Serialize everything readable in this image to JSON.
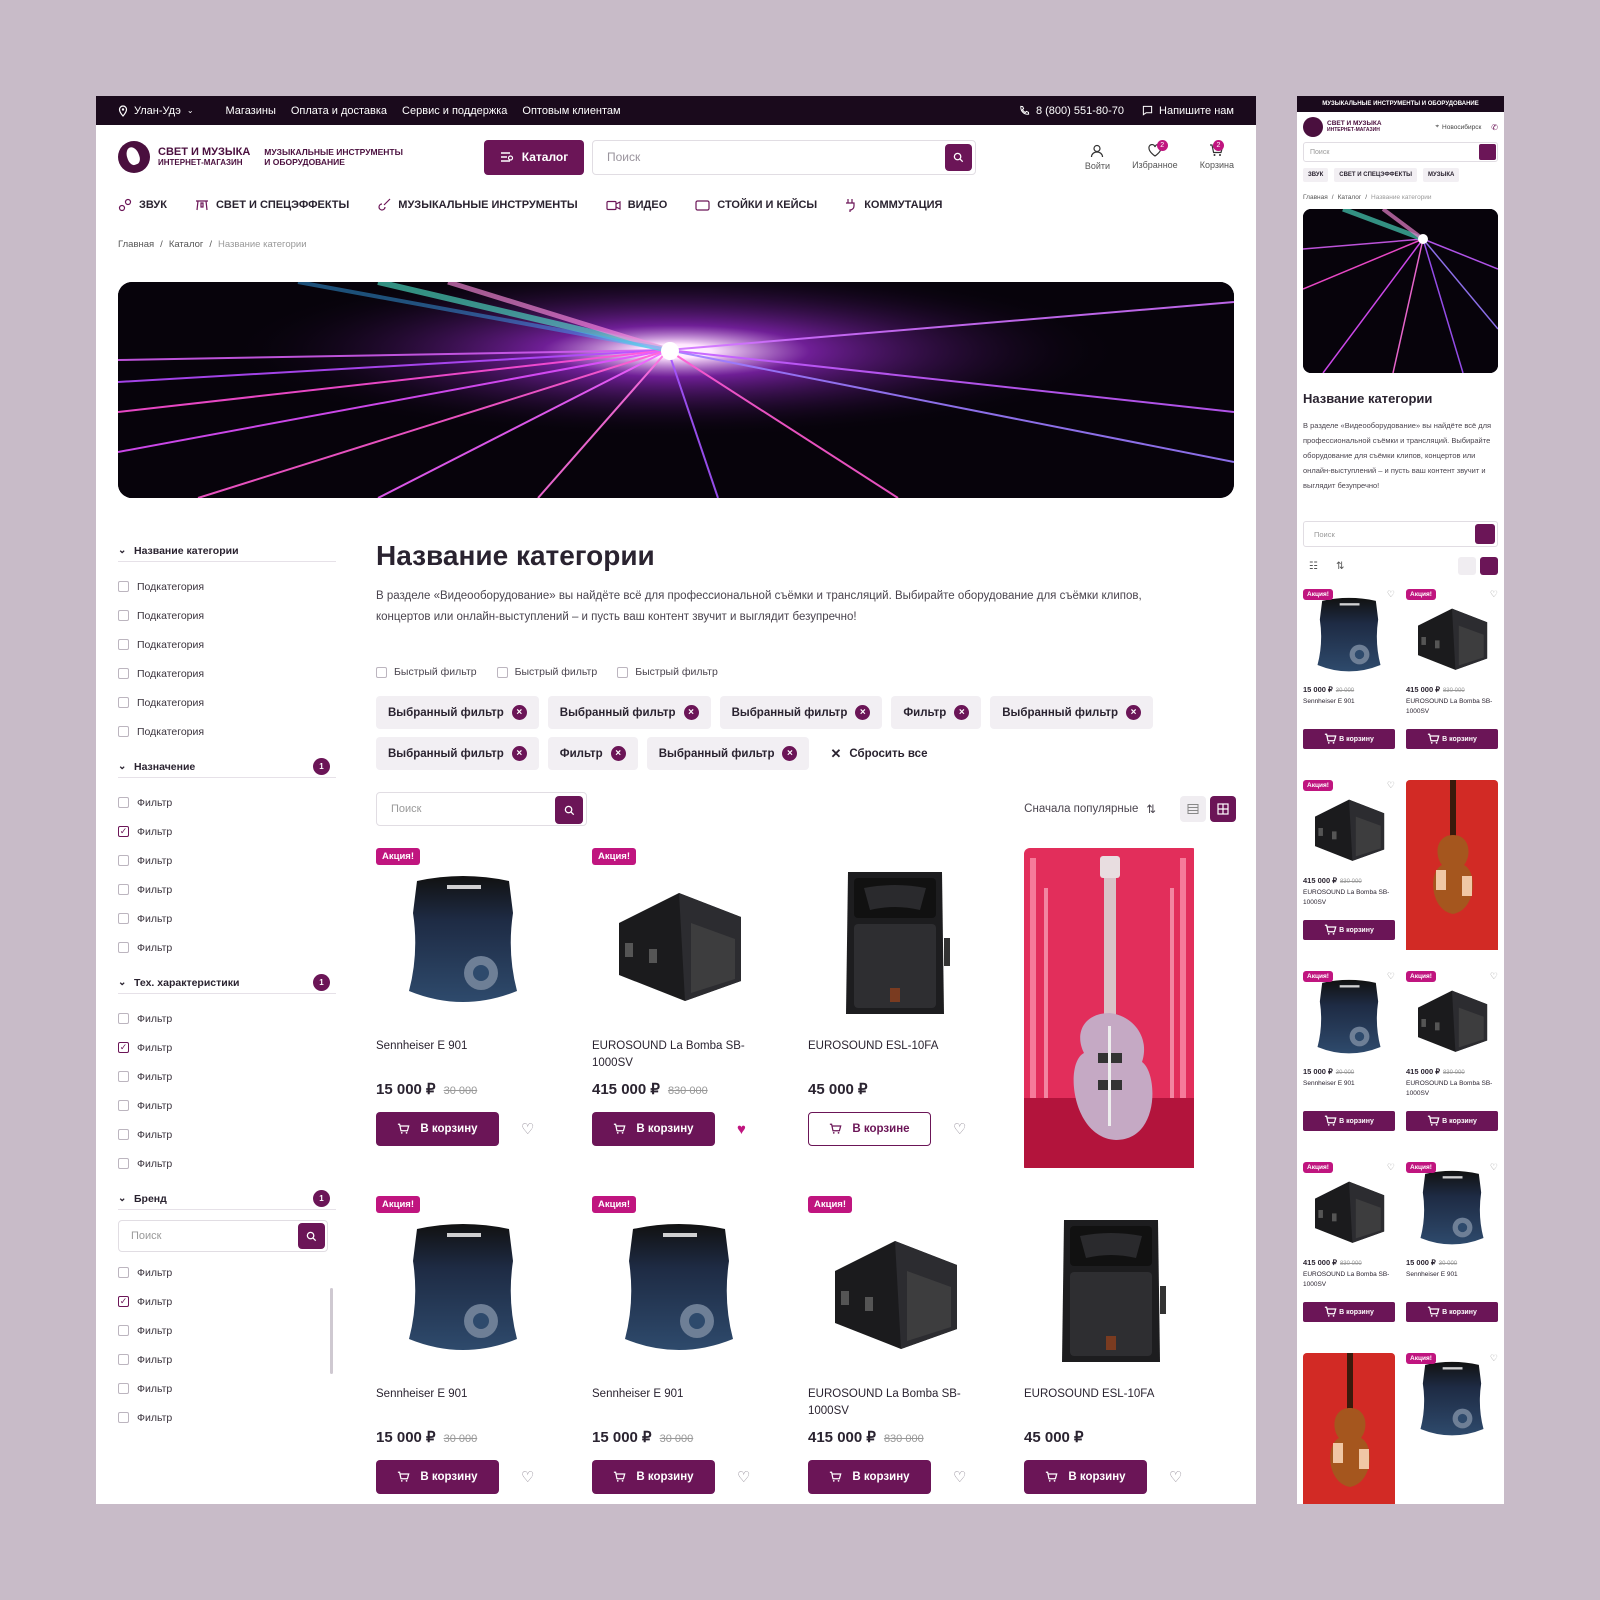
{
  "topbar": {
    "city": "Улан-Удэ",
    "links": [
      "Магазины",
      "Оплата и доставка",
      "Сервис и поддержка",
      "Оптовым клиентам"
    ],
    "phone": "8 (800) 551-80-70",
    "write_us": "Напишите нам"
  },
  "header": {
    "logo_title": "СВЕТ И МУЗЫКА",
    "logo_subtitle": "ИНТЕРНЕТ-МАГАЗИН",
    "logo_tagline_1": "МУЗЫКАЛЬНЫЕ ИНСТРУМЕНТЫ",
    "logo_tagline_2": "И ОБОРУДОВАНИЕ",
    "catalog_label": "Каталог",
    "search_placeholder": "Поиск",
    "login_label": "Войти",
    "favorites_label": "Избранное",
    "favorites_count": "2",
    "cart_label": "Корзина",
    "cart_count": "2"
  },
  "catnav": [
    "ЗВУК",
    "СВЕТ И СПЕЦЭФФЕКТЫ",
    "МУЗЫКАЛЬНЫЕ ИНСТРУМЕНТЫ",
    "ВИДЕО",
    "СТОЙКИ И КЕЙСЫ",
    "КОММУТАЦИЯ"
  ],
  "breadcrumb": [
    "Главная",
    "Каталог",
    "Название категории"
  ],
  "sidebar": {
    "groups": [
      {
        "title": "Название категории",
        "count": "",
        "items": [
          {
            "label": "Подкатегория",
            "checked": false
          },
          {
            "label": "Подкатегория",
            "checked": false
          },
          {
            "label": "Подкатегория",
            "checked": false
          },
          {
            "label": "Подкатегория",
            "checked": false
          },
          {
            "label": "Подкатегория",
            "checked": false
          },
          {
            "label": "Подкатегория",
            "checked": false
          }
        ]
      },
      {
        "title": "Назначение",
        "count": "1",
        "items": [
          {
            "label": "Фильтр",
            "checked": false
          },
          {
            "label": "Фильтр",
            "checked": true
          },
          {
            "label": "Фильтр",
            "checked": false
          },
          {
            "label": "Фильтр",
            "checked": false
          },
          {
            "label": "Фильтр",
            "checked": false
          },
          {
            "label": "Фильтр",
            "checked": false
          }
        ]
      },
      {
        "title": "Тех. характеристики",
        "count": "1",
        "items": [
          {
            "label": "Фильтр",
            "checked": false
          },
          {
            "label": "Фильтр",
            "checked": true
          },
          {
            "label": "Фильтр",
            "checked": false
          },
          {
            "label": "Фильтр",
            "checked": false
          },
          {
            "label": "Фильтр",
            "checked": false
          },
          {
            "label": "Фильтр",
            "checked": false
          }
        ]
      },
      {
        "title": "Бренд",
        "count": "1",
        "search": "Поиск",
        "items": [
          {
            "label": "Фильтр",
            "checked": false
          },
          {
            "label": "Фильтр",
            "checked": true
          },
          {
            "label": "Фильтр",
            "checked": false
          },
          {
            "label": "Фильтр",
            "checked": false
          },
          {
            "label": "Фильтр",
            "checked": false
          },
          {
            "label": "Фильтр",
            "checked": false
          }
        ]
      }
    ]
  },
  "main": {
    "title": "Название категории",
    "description": "В разделе «Видеооборудование» вы найдёте всё для профессиональной съёмки и трансляций. Выбирайте оборудование для съёмки клипов, концертов или онлайн-выступлений – и пусть ваш контент звучит и выглядит безупречно!",
    "quick_filters": [
      "Быстрый фильтр",
      "Быстрый фильтр",
      "Быстрый фильтр"
    ],
    "chips": [
      "Выбранный фильтр",
      "Выбранный фильтр",
      "Выбранный фильтр",
      "Фильтр",
      "Выбранный фильтр",
      "Выбранный фильтр",
      "Фильтр",
      "Выбранный фильтр"
    ],
    "reset_label": "Сбросить все",
    "search_placeholder": "Поиск",
    "sort_label": "Сначала популярные"
  },
  "promo_label": "Акция!",
  "cart_button": "В корзину",
  "in_cart_button": "В корзине",
  "products": [
    {
      "kind": "mic",
      "promo": true,
      "name": "Sennheiser E 901",
      "price": "15 000 ₽",
      "old": "30 000",
      "in_cart": false,
      "fav": false
    },
    {
      "kind": "sub",
      "promo": true,
      "name": "EUROSOUND La Bomba SB-1000SV",
      "price": "415 000 ₽",
      "old": "830 000",
      "in_cart": false,
      "fav": true
    },
    {
      "kind": "spk",
      "promo": false,
      "name": "EUROSOUND ESL-10FA",
      "price": "45 000 ₽",
      "old": "",
      "in_cart": true,
      "fav": false
    },
    {
      "kind": "guitar",
      "photo": true
    },
    {
      "kind": "mic",
      "promo": true,
      "name": "Sennheiser E 901",
      "price": "15 000 ₽",
      "old": "30 000",
      "in_cart": false,
      "fav": false
    },
    {
      "kind": "mic",
      "promo": true,
      "name": "Sennheiser E 901",
      "price": "15 000 ₽",
      "old": "30 000",
      "in_cart": false,
      "fav": false
    },
    {
      "kind": "sub",
      "promo": true,
      "name": "EUROSOUND La Bomba SB-1000SV",
      "price": "415 000 ₽",
      "old": "830 000",
      "in_cart": false,
      "fav": false
    },
    {
      "kind": "spk",
      "promo": false,
      "name": "EUROSOUND ESL-10FA",
      "price": "45 000 ₽",
      "old": "",
      "in_cart": false,
      "fav": false
    }
  ],
  "mobile": {
    "top": "МУЗЫКАЛЬНЫЕ ИНСТРУМЕНТЫ И ОБОРУДОВАНИЕ",
    "city": "Новосибирск",
    "search_placeholder": "Поиск",
    "catnav": [
      "ЗВУК",
      "СВЕТ И СПЕЦЭФФЕКТЫ",
      "МУЗЫКА"
    ],
    "products": [
      {
        "kind": "mic",
        "promo": true,
        "price": "15 000 ₽",
        "old": "30 000",
        "name": "Sennheiser E 901"
      },
      {
        "kind": "sub",
        "promo": true,
        "price": "415 000 ₽",
        "old": "830 000",
        "name": "EUROSOUND La Bomba SB-1000SV"
      },
      {
        "kind": "sub",
        "promo": true,
        "price": "415 000 ₽",
        "old": "830 000",
        "name": "EUROSOUND La Bomba SB-1000SV"
      },
      {
        "kind": "violin",
        "photo": true
      },
      {
        "kind": "mic",
        "promo": true,
        "price": "15 000 ₽",
        "old": "30 000",
        "name": "Sennheiser E 901"
      },
      {
        "kind": "sub",
        "promo": true,
        "price": "415 000 ₽",
        "old": "830 000",
        "name": "EUROSOUND La Bomba SB-1000SV"
      },
      {
        "kind": "sub",
        "promo": true,
        "price": "415 000 ₽",
        "old": "830 000",
        "name": "EUROSOUND La Bomba SB-1000SV"
      },
      {
        "kind": "mic",
        "promo": true,
        "price": "15 000 ₽",
        "old": "30 000",
        "name": "Sennheiser E 901"
      },
      {
        "kind": "violin",
        "photo": true
      },
      {
        "kind": "mic",
        "promo": true
      }
    ]
  },
  "colors": {
    "brand": "#6b1557",
    "accent": "#c0157f",
    "dark": "#1a0a1c"
  }
}
